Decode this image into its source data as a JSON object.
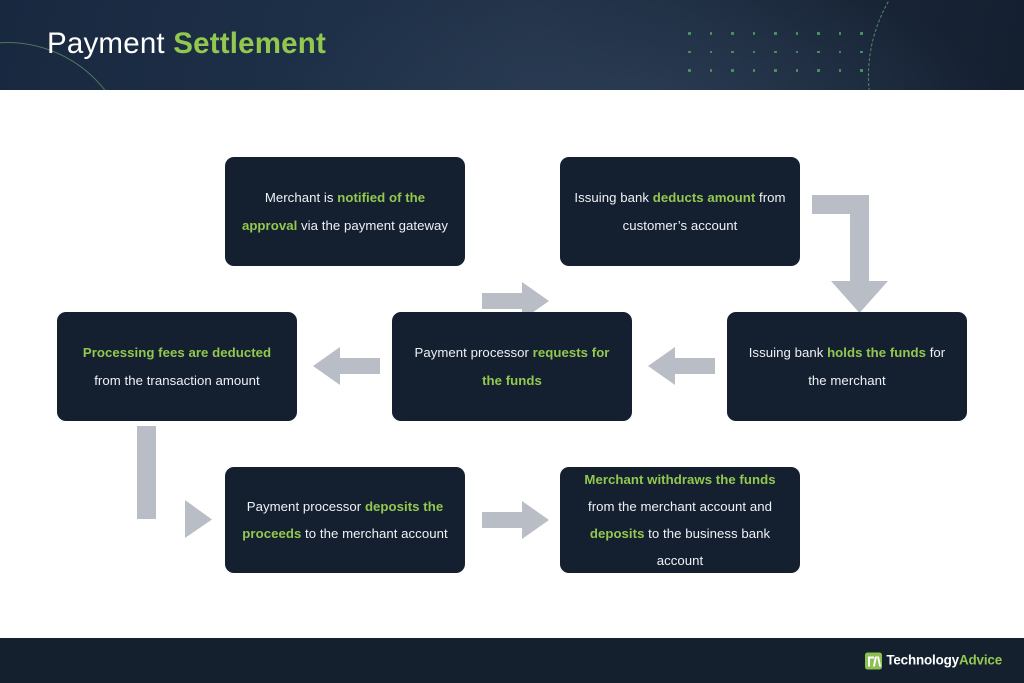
{
  "header": {
    "title_plain": "Payment ",
    "title_accent": "Settlement",
    "decor": {
      "dot_grid_icon": "dot-grid-decoration",
      "arc_left_icon": "arc-curve-decoration",
      "arc_right_icon": "dashed-arc-decoration"
    }
  },
  "colors": {
    "accent_green": "#93c84f",
    "box_navy": "#141f30",
    "header_navy": "#1a2739",
    "arrow_gray": "#b9bec6",
    "page_white": "#ffffff",
    "footer_navy": "#15202f"
  },
  "flow": {
    "type": "flowchart",
    "direction": "serpentine-left-to-right-then-right-to-left",
    "nodes": [
      {
        "id": "step-1",
        "order": 1,
        "row": 1,
        "full_text": "Merchant is notified of the approval via the payment gateway",
        "segments": [
          {
            "text": "Merchant is ",
            "emphasis": false
          },
          {
            "text": "notified of the approval",
            "emphasis": true
          },
          {
            "text": " via the payment gateway",
            "emphasis": false
          }
        ]
      },
      {
        "id": "step-2",
        "order": 2,
        "row": 1,
        "full_text": "Issuing bank deducts amount from customer's account",
        "segments": [
          {
            "text": "Issuing bank ",
            "emphasis": false
          },
          {
            "text": "deducts amount",
            "emphasis": true
          },
          {
            "text": " from customer’s account",
            "emphasis": false
          }
        ]
      },
      {
        "id": "step-3",
        "order": 3,
        "row": 2,
        "full_text": "Issuing bank holds the funds for the merchant",
        "segments": [
          {
            "text": "Issuing bank ",
            "emphasis": false
          },
          {
            "text": "holds the funds",
            "emphasis": true
          },
          {
            "text": " for the merchant",
            "emphasis": false
          }
        ]
      },
      {
        "id": "step-4",
        "order": 4,
        "row": 2,
        "full_text": "Payment processor requests for the funds",
        "segments": [
          {
            "text": "Payment processor ",
            "emphasis": false
          },
          {
            "text": "requests for the funds",
            "emphasis": true
          }
        ]
      },
      {
        "id": "step-5",
        "order": 5,
        "row": 2,
        "full_text": "Processing fees are deducted from the transaction amount",
        "segments": [
          {
            "text": "Processing fees are deducted",
            "emphasis": true
          },
          {
            "text": " from the transaction amount",
            "emphasis": false
          }
        ]
      },
      {
        "id": "step-6",
        "order": 6,
        "row": 3,
        "full_text": "Payment processor deposits the proceeds to the merchant account",
        "segments": [
          {
            "text": "Payment processor ",
            "emphasis": false
          },
          {
            "text": "deposits the proceeds",
            "emphasis": true
          },
          {
            "text": " to the merchant account",
            "emphasis": false
          }
        ]
      },
      {
        "id": "step-7",
        "order": 7,
        "row": 3,
        "full_text": "Merchant withdraws the funds from the merchant account and deposits to the business bank account",
        "segments": [
          {
            "text": "Merchant withdraws the funds",
            "emphasis": true
          },
          {
            "text": " from the merchant account and ",
            "emphasis": false
          },
          {
            "text": "deposits",
            "emphasis": true
          },
          {
            "text": " to the business bank account",
            "emphasis": false
          }
        ]
      }
    ],
    "connectors": [
      {
        "id": "c1",
        "from": "step-1",
        "to": "step-2",
        "shape": "straight",
        "direction": "right"
      },
      {
        "id": "c2",
        "from": "step-2",
        "to": "step-3",
        "shape": "elbow",
        "direction": "right-then-down"
      },
      {
        "id": "c3",
        "from": "step-3",
        "to": "step-4",
        "shape": "straight",
        "direction": "left"
      },
      {
        "id": "c4",
        "from": "step-4",
        "to": "step-5",
        "shape": "straight",
        "direction": "left"
      },
      {
        "id": "c5",
        "from": "step-5",
        "to": "step-6",
        "shape": "elbow",
        "direction": "down-then-right"
      },
      {
        "id": "c6",
        "from": "step-6",
        "to": "step-7",
        "shape": "straight",
        "direction": "right"
      }
    ]
  },
  "footer": {
    "logo_mark_icon": "technologyadvice-monogram-icon",
    "logo_text_primary": "Technology",
    "logo_text_accent": "Advice"
  }
}
